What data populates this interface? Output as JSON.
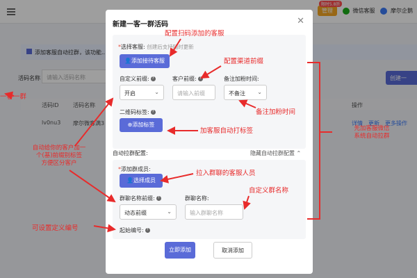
{
  "background": {
    "badge": "限时5.8折",
    "upgrade_button": "管理",
    "wechat_service": "微信客服",
    "brand": "摩尔企鹅",
    "notice": "添加客服自动拉群，该功能...",
    "filter_label": "活码名称",
    "filter_placeholder": "请输入活码名称",
    "create_button": "创建一",
    "table_headers": [
      "活码ID",
      "活码名称",
      "操作"
    ],
    "row": {
      "id": "lv0nu3",
      "name": "摩尔微客满3",
      "ops": [
        "详情",
        "更新",
        "更多操作"
      ]
    }
  },
  "modal": {
    "title": "新建一客一群活码",
    "select_service_label": "选择客服:",
    "select_service_hint": "创建后支持随时更新",
    "add_service_button": "添加接待客服",
    "custom_prefix_label": "自定义前缀:",
    "custom_prefix_value": "开启",
    "customer_prefix_label": "客户前缀:",
    "customer_prefix_placeholder": "请输入前缀",
    "remark_time_label": "备注加粉时间:",
    "remark_time_value": "不备注",
    "qr_tag_label": "二维码标签:",
    "add_tag_button": "添加标签",
    "auto_group_label": "自动拉群配置:",
    "hide_config_link": "隐藏自动拉群配置",
    "add_member_label": "添加群成员:",
    "select_member_button": "选择成员",
    "group_prefix_label": "群聊名称前缀:",
    "group_prefix_value": "动态前缀",
    "group_name_label": "群聊名称:",
    "group_name_placeholder": "输入群聊名称",
    "start_number_label": "起始编号:",
    "submit_button": "立即添加",
    "cancel_button": "取消添加"
  },
  "annotations": {
    "configure_service": "配置扫码添加的客服",
    "configure_prefix": "配置渠道前缀",
    "remark_time": "备注加粉时间",
    "auto_tag": "加客服自动打标签",
    "member": "拉入群聊的客服人员",
    "custom_group_name": "自定义群名称",
    "auto_group": "先加客服微信\n系统自动拉群",
    "dynamic_prefix": "自动给你的客户加一\n个(基)前缀别标签\n方便区分客户",
    "custom_number": "可设置定义编号",
    "left_edge": "一客一群"
  },
  "colors": {
    "primary": "#5a6bd8",
    "annotation": "#e82b2b",
    "overlay": "rgba(0,0,0,0.38)"
  }
}
